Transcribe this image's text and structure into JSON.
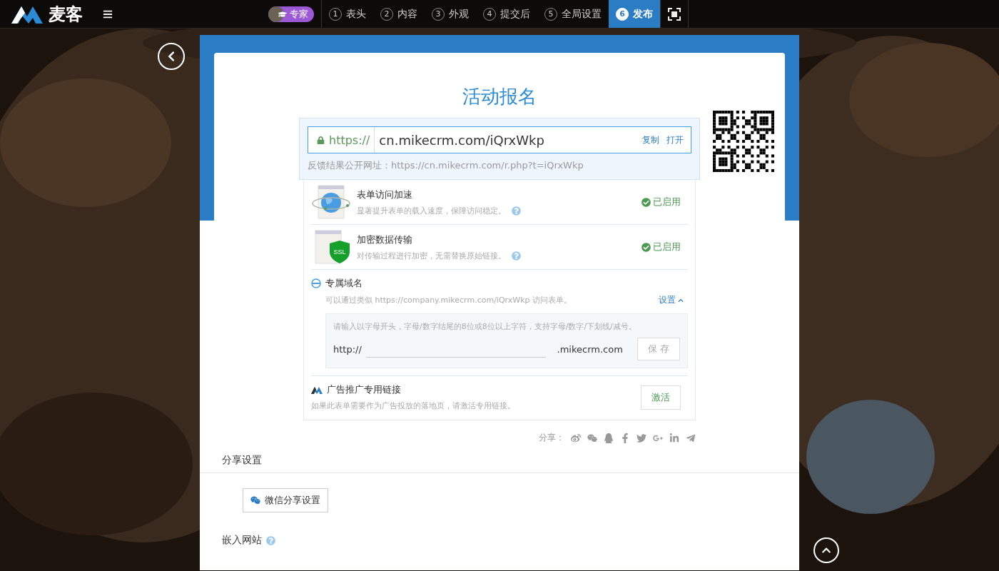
{
  "topbar": {
    "logo": "麦客",
    "expert_toggle": {
      "label": "专家",
      "on": true
    }
  },
  "steps": [
    {
      "number": "1",
      "label": "表头",
      "selected": false
    },
    {
      "number": "2",
      "label": "内容",
      "selected": false
    },
    {
      "number": "3",
      "label": "外观",
      "selected": false
    },
    {
      "number": "4",
      "label": "提交后",
      "selected": false
    },
    {
      "number": "5",
      "label": "全局设置",
      "selected": false
    },
    {
      "number": "6",
      "label": "发布",
      "selected": true
    }
  ],
  "form": {
    "title": "活动报名",
    "url": {
      "scheme": "https://",
      "value": "cn.mikecrm.com/iQrxWkp",
      "actions": [
        "复制",
        "打开"
      ]
    },
    "result_url": "反馈结果公开网址：https://cn.mikecrm.com/r.php?t=iQrxWkp",
    "features": [
      {
        "kind": "speed",
        "title": "表单访问加速",
        "description": "显著提升表单的载入速度，保障访问稳定。",
        "status": "已启用",
        "enabled": true
      },
      {
        "kind": "ssl",
        "icon_label": "SSL",
        "title": "加密数据传输",
        "description": "对传输过程进行加密，无需替换原始链接。",
        "status": "已启用",
        "enabled": true
      },
      {
        "kind": "domain",
        "title": "专属域名",
        "description": "可以通过类似 https://company.mikecrm.com/iQrxWkp 访问表单。",
        "toggle": "设置",
        "expanded": true,
        "hint": "请输入以字母开头，字母/数字结尾的8位或8位以上字符，支持字母/数字/下划线/减号。",
        "prefix": "http://",
        "suffix": ".mikecrm.com",
        "button": "保 存",
        "disabled": true
      },
      {
        "kind": "action",
        "title": "广告推广专用链接",
        "description": "如果此表单需要作为广告投放的落地页，请激活专用链接。",
        "button": "激活"
      }
    ],
    "share_label": "分享："
  },
  "share_settings": {
    "heading": "分享设置",
    "wechat_button": "微信分享设置"
  },
  "embed": {
    "heading": "嵌入网站"
  }
}
